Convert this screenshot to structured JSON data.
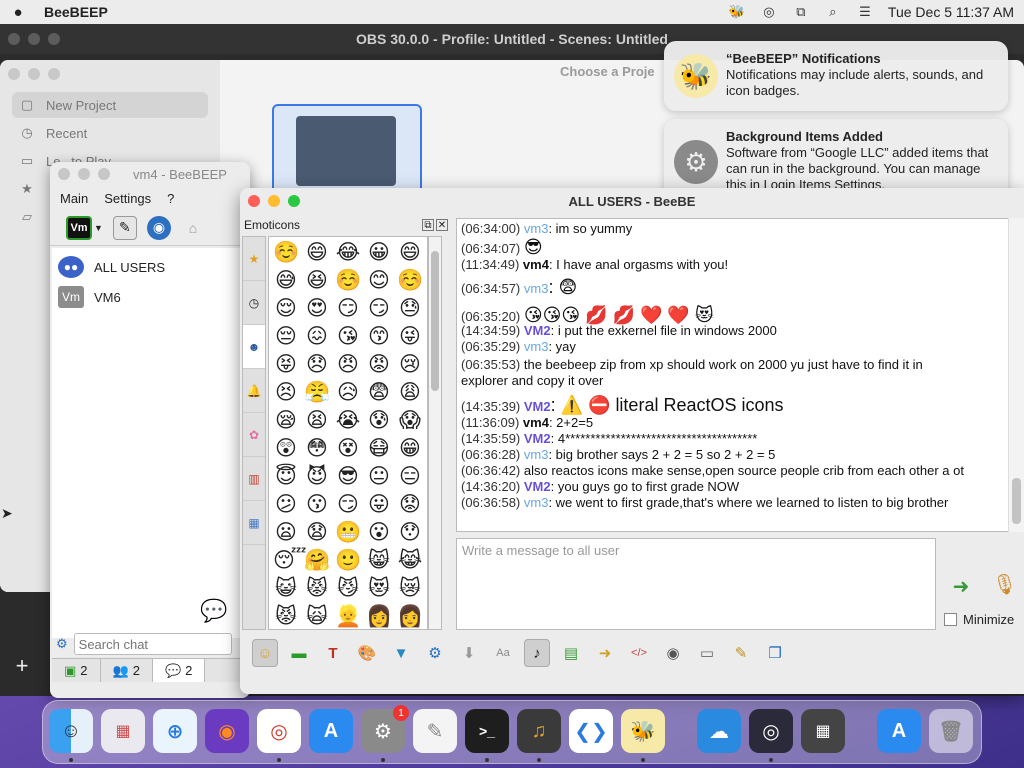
{
  "menubar": {
    "app": "BeeBEEP",
    "datetime": "Tue Dec 5  11:37 AM"
  },
  "obs": {
    "title": "OBS 30.0.0 - Profile: Untitled - Scenes: Untitled"
  },
  "project": {
    "choose": "Choose a Proje",
    "items": [
      {
        "label": "New Project"
      },
      {
        "label": "Recent"
      },
      {
        "label": "Le...to Play"
      }
    ]
  },
  "vm4": {
    "title": "vm4 - BeeBEEP",
    "menu": {
      "main": "Main",
      "settings": "Settings",
      "help": "?"
    },
    "users": [
      {
        "name": "ALL USERS"
      },
      {
        "name": "VM6",
        "avatar": "Vm"
      }
    ],
    "search_placeholder": "Search chat",
    "tabs": [
      {
        "count": "2"
      },
      {
        "count": "2"
      },
      {
        "count": "2"
      }
    ],
    "vm_badge": "Vm"
  },
  "chat": {
    "title": "ALL USERS - BeeBE",
    "emoticons_title": "Emoticons",
    "input_placeholder": "Write a message to all user",
    "minimize_label": "Minimize",
    "messages": [
      {
        "time": "(06:34:00)",
        "user": "vm3",
        "text": ": im so yummy"
      },
      {
        "time": "(06:34:07)",
        "user": "",
        "text": "😎"
      },
      {
        "time": "(11:34:49)",
        "user": "vm4",
        "text": ": I have anal orgasms with you!"
      },
      {
        "time": "(06:34:57)",
        "user": "vm3",
        "text": ": 😨"
      },
      {
        "time": "(06:35:20)",
        "user": "",
        "text": "😘😘😘 💋 💋 ❤️ ❤️ 😻"
      },
      {
        "time": "(14:34:59)",
        "user": "VM2",
        "text": ": i put the exkernel file in windows 2000"
      },
      {
        "time": "(06:35:29)",
        "user": "vm3",
        "text": ": yay"
      },
      {
        "time": "(06:35:53)",
        "user": "",
        "text": "the beebeep zip from xp should work on 2000 yu just have to find it in"
      },
      {
        "time": "",
        "user": "",
        "text": "explorer and copy   it over"
      },
      {
        "time": "(14:35:39)",
        "user": "VM2",
        "text": ": ⚠️ ⛔ literal ReactOS icons"
      },
      {
        "time": "(11:36:09)",
        "user": "vm4",
        "text": ": 2+2=5"
      },
      {
        "time": "(14:35:59)",
        "user": "VM2",
        "text": ": 4**************************************"
      },
      {
        "time": "(06:36:28)",
        "user": "vm3",
        "text": ": big brother says 2 + 2 = 5 so 2 + 2 = 5"
      },
      {
        "time": "(06:36:42)",
        "user": "",
        "text": "also reactos icons make sense,open source people crib from each other a ot"
      },
      {
        "time": "(14:36:20)",
        "user": "VM2",
        "text": ": you guys go to first grade NOW"
      },
      {
        "time": "(06:36:58)",
        "user": "vm3",
        "text": ": we went to first grade,that's where we learned to listen to big brother"
      }
    ],
    "emojis": [
      "☺️",
      "😄",
      "😂",
      "😀",
      "😄",
      "😅",
      "😆",
      "☺️",
      "😊",
      "☺️",
      "😌",
      "😍",
      "😏",
      "😏",
      "😓",
      "😔",
      "😖",
      "😘",
      "😙",
      "😜",
      "😝",
      "😞",
      "😠",
      "😡",
      "😢",
      "😣",
      "😤",
      "😥",
      "😨",
      "😩",
      "😪",
      "😫",
      "😭",
      "😰",
      "😱",
      "😲",
      "😳",
      "😵",
      "😷",
      "😁",
      "😇",
      "😈",
      "😎",
      "😐",
      "😑",
      "😕",
      "😗",
      "😏",
      "😛",
      "😟",
      "😦",
      "😧",
      "😬",
      "😮",
      "😯",
      "😴",
      "🤗",
      "🙂",
      "😸",
      "😹",
      "😺",
      "😾",
      "😼",
      "😻",
      "😿",
      "😾",
      "🙀",
      "👱",
      "👩",
      "👩"
    ]
  },
  "notifications": [
    {
      "title": "“BeeBEEP” Notifications",
      "body": "Notifications may include alerts, sounds, and icon badges."
    },
    {
      "title": "Background Items Added",
      "body": "Software from “Google LLC” added items that can run in the background. You can manage this in Login Items Settings."
    }
  ],
  "dock": {
    "badge": "1"
  },
  "colors": {
    "vm3": "#6aa6e8",
    "vm2": "#6a4fd8",
    "selection": "#3b7ae6"
  }
}
